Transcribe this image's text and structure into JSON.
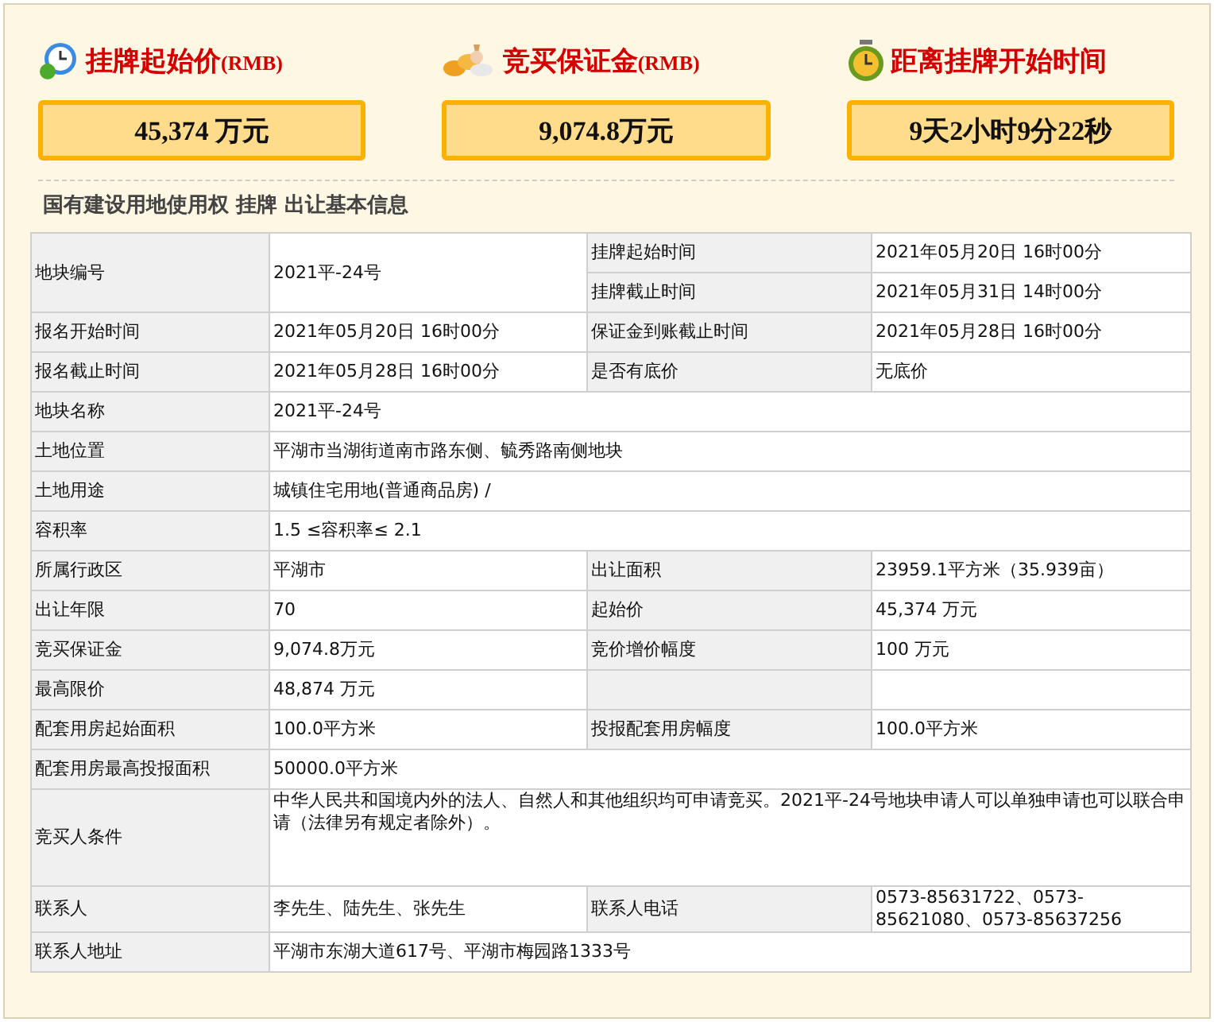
{
  "stats": [
    {
      "kind": "clock",
      "title": "挂牌起始价",
      "unit": "(RMB)",
      "value": "45,374 万元"
    },
    {
      "kind": "coins",
      "title": "竞买保证金",
      "unit": "(RMB)",
      "value": "9,074.8万元"
    },
    {
      "kind": "alarm",
      "title": "距离挂牌开始时间",
      "value": "9天2小时9分22秒"
    }
  ],
  "section_title": "国有建设用地使用权 挂牌 出让基本信息",
  "table": {
    "rows": [
      [
        {
          "kind": "label",
          "text": "地块编号",
          "rowspan": 2
        },
        {
          "kind": "value",
          "text": "2021平-24号",
          "rowspan": 2
        },
        {
          "kind": "label",
          "text": "挂牌起始时间"
        },
        {
          "kind": "value",
          "text": "2021年05月20日 16时00分"
        }
      ],
      [
        {
          "kind": "label",
          "text": "挂牌截止时间"
        },
        {
          "kind": "value",
          "text": "2021年05月31日 14时00分"
        }
      ],
      [
        {
          "kind": "label",
          "text": "报名开始时间"
        },
        {
          "kind": "value",
          "text": "2021年05月20日 16时00分"
        },
        {
          "kind": "label",
          "text": "保证金到账截止时间"
        },
        {
          "kind": "value",
          "text": "2021年05月28日 16时00分"
        }
      ],
      [
        {
          "kind": "label",
          "text": "报名截止时间"
        },
        {
          "kind": "value",
          "text": "2021年05月28日 16时00分"
        },
        {
          "kind": "label",
          "text": "是否有底价"
        },
        {
          "kind": "value",
          "text": "无底价"
        }
      ],
      [
        {
          "kind": "label",
          "text": "地块名称"
        },
        {
          "kind": "value",
          "text": "2021平-24号",
          "colspan": 3
        }
      ],
      [
        {
          "kind": "label",
          "text": "土地位置"
        },
        {
          "kind": "value",
          "text": "平湖市当湖街道南市路东侧、毓秀路南侧地块",
          "colspan": 3
        }
      ],
      [
        {
          "kind": "label",
          "text": "土地用途"
        },
        {
          "kind": "value",
          "text": "城镇住宅用地(普通商品房) /",
          "colspan": 3
        }
      ],
      [
        {
          "kind": "label",
          "text": "容积率"
        },
        {
          "kind": "value",
          "text": "1.5 ≤容积率≤ 2.1",
          "colspan": 3
        }
      ],
      [
        {
          "kind": "label",
          "text": "所属行政区"
        },
        {
          "kind": "value",
          "text": "平湖市"
        },
        {
          "kind": "label",
          "text": "出让面积"
        },
        {
          "kind": "value",
          "text": "23959.1平方米（35.939亩）"
        }
      ],
      [
        {
          "kind": "label",
          "text": "出让年限"
        },
        {
          "kind": "value",
          "text": "70"
        },
        {
          "kind": "label",
          "text": "起始价"
        },
        {
          "kind": "value",
          "text": "45,374 万元"
        }
      ],
      [
        {
          "kind": "label",
          "text": "竞买保证金"
        },
        {
          "kind": "value",
          "text": "9,074.8万元"
        },
        {
          "kind": "label",
          "text": "竞价增价幅度"
        },
        {
          "kind": "value",
          "text": "100 万元"
        }
      ],
      [
        {
          "kind": "label",
          "text": "最高限价"
        },
        {
          "kind": "value",
          "text": "48,874 万元"
        },
        {
          "kind": "label"
        },
        {
          "kind": "value"
        }
      ],
      [
        {
          "kind": "label",
          "text": "配套用房起始面积"
        },
        {
          "kind": "value",
          "text": "100.0平方米"
        },
        {
          "kind": "label",
          "text": "投报配套用房幅度"
        },
        {
          "kind": "value",
          "text": "100.0平方米"
        }
      ],
      [
        {
          "kind": "label",
          "text": "配套用房最高投报面积"
        },
        {
          "kind": "value",
          "text": "50000.0平方米",
          "colspan": 3
        }
      ],
      [
        {
          "kind": "label",
          "text": "竞买人条件"
        },
        {
          "kind": "paragraph",
          "text": "中华人民共和国境内外的法人、自然人和其他组织均可申请竞买。2021平-24号地块申请人可以单独申请也可以联合申请（法律另有规定者除外）。",
          "colspan": 3
        }
      ],
      [
        {
          "kind": "label",
          "text": "联系人"
        },
        {
          "kind": "value",
          "text": "李先生、陆先生、张先生"
        },
        {
          "kind": "label",
          "text": "联系人电话"
        },
        {
          "kind": "value",
          "text": "0573-85631722、0573-85621080、0573-85637256"
        }
      ],
      [
        {
          "kind": "label",
          "text": "联系人地址"
        },
        {
          "kind": "value",
          "text": "平湖市东湖大道617号、平湖市梅园路1333号",
          "colspan": 3
        }
      ]
    ]
  }
}
